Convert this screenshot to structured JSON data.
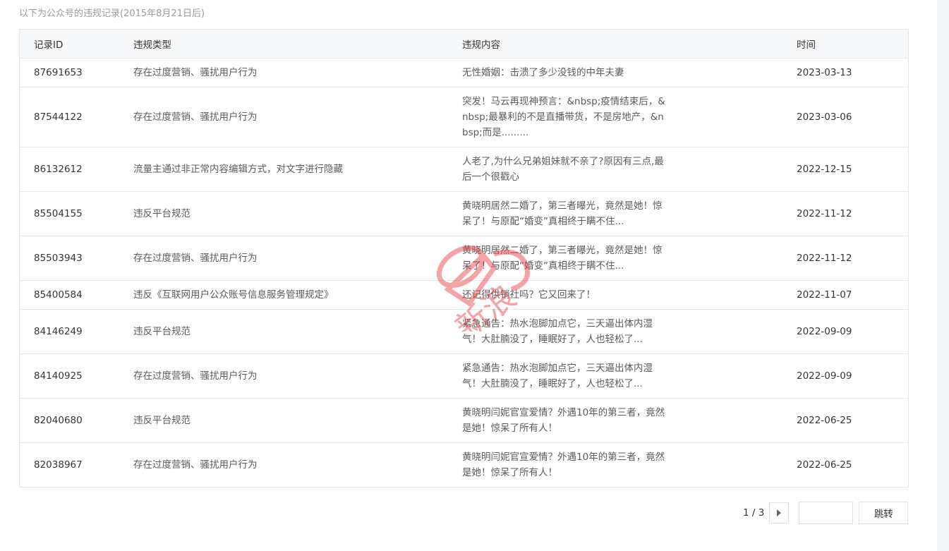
{
  "caption": "以下为公众号的违规记录(2015年8月21日后)",
  "table": {
    "headers": {
      "id": "记录ID",
      "type": "违规类型",
      "content": "违规内容",
      "time": "时间"
    },
    "rows": [
      {
        "id": "87691653",
        "type": "存在过度营销、骚扰用户行为",
        "content": "无性婚姻：击溃了多少没钱的中年夫妻",
        "time": "2023-03-13"
      },
      {
        "id": "87544122",
        "type": "存在过度营销、骚扰用户行为",
        "content": "突发！马云再现神预言：&nbsp;疫情结束后，&nbsp;最暴利的不是直播带货，不是房地产，&nbsp;而是.........",
        "time": "2023-03-06"
      },
      {
        "id": "86132612",
        "type": "流量主通过非正常内容编辑方式，对文字进行隐藏",
        "content": "人老了,为什么兄弟姐妹就不亲了?原因有三点,最后一个很戳心",
        "time": "2022-12-15"
      },
      {
        "id": "85504155",
        "type": "违反平台规范",
        "content": "黄晓明居然二婚了，第三者曝光，竟然是她！惊呆了！与原配“婚变”真相终于瞒不住...",
        "time": "2022-11-12"
      },
      {
        "id": "85503943",
        "type": "存在过度营销、骚扰用户行为",
        "content": "黄晓明居然二婚了，第三者曝光，竟然是她！惊呆了！与原配“婚变”真相终于瞒不住...",
        "time": "2022-11-12"
      },
      {
        "id": "85400584",
        "type": "违反《互联网用户公众账号信息服务管理规定》",
        "content": "还记得供销社吗？它又回来了！",
        "time": "2022-11-07"
      },
      {
        "id": "84146249",
        "type": "违反平台规范",
        "content": "紧急通告：热水泡脚加点它，三天逼出体内湿气！大肚腩没了，睡眠好了，人也轻松了...",
        "time": "2022-09-09"
      },
      {
        "id": "84140925",
        "type": "存在过度营销、骚扰用户行为",
        "content": "紧急通告：热水泡脚加点它，三天逼出体内湿气！大肚腩没了，睡眠好了，人也轻松了...",
        "time": "2022-09-09"
      },
      {
        "id": "82040680",
        "type": "违反平台规范",
        "content": "黄晓明闫妮官宣爱情？外遇10年的第三者，竟然是她！惊呆了所有人！",
        "time": "2022-06-25"
      },
      {
        "id": "82038967",
        "type": "存在过度营销、骚扰用户行为",
        "content": "黄晓明闫妮官宣爱情？外遇10年的第三者，竟然是她！惊呆了所有人！",
        "time": "2022-06-25"
      }
    ]
  },
  "pager": {
    "page_info": "1 / 3",
    "jump_input_value": "",
    "jump_label": "跳转"
  },
  "watermark": {
    "text": "新浪",
    "color": "#e8353b"
  }
}
